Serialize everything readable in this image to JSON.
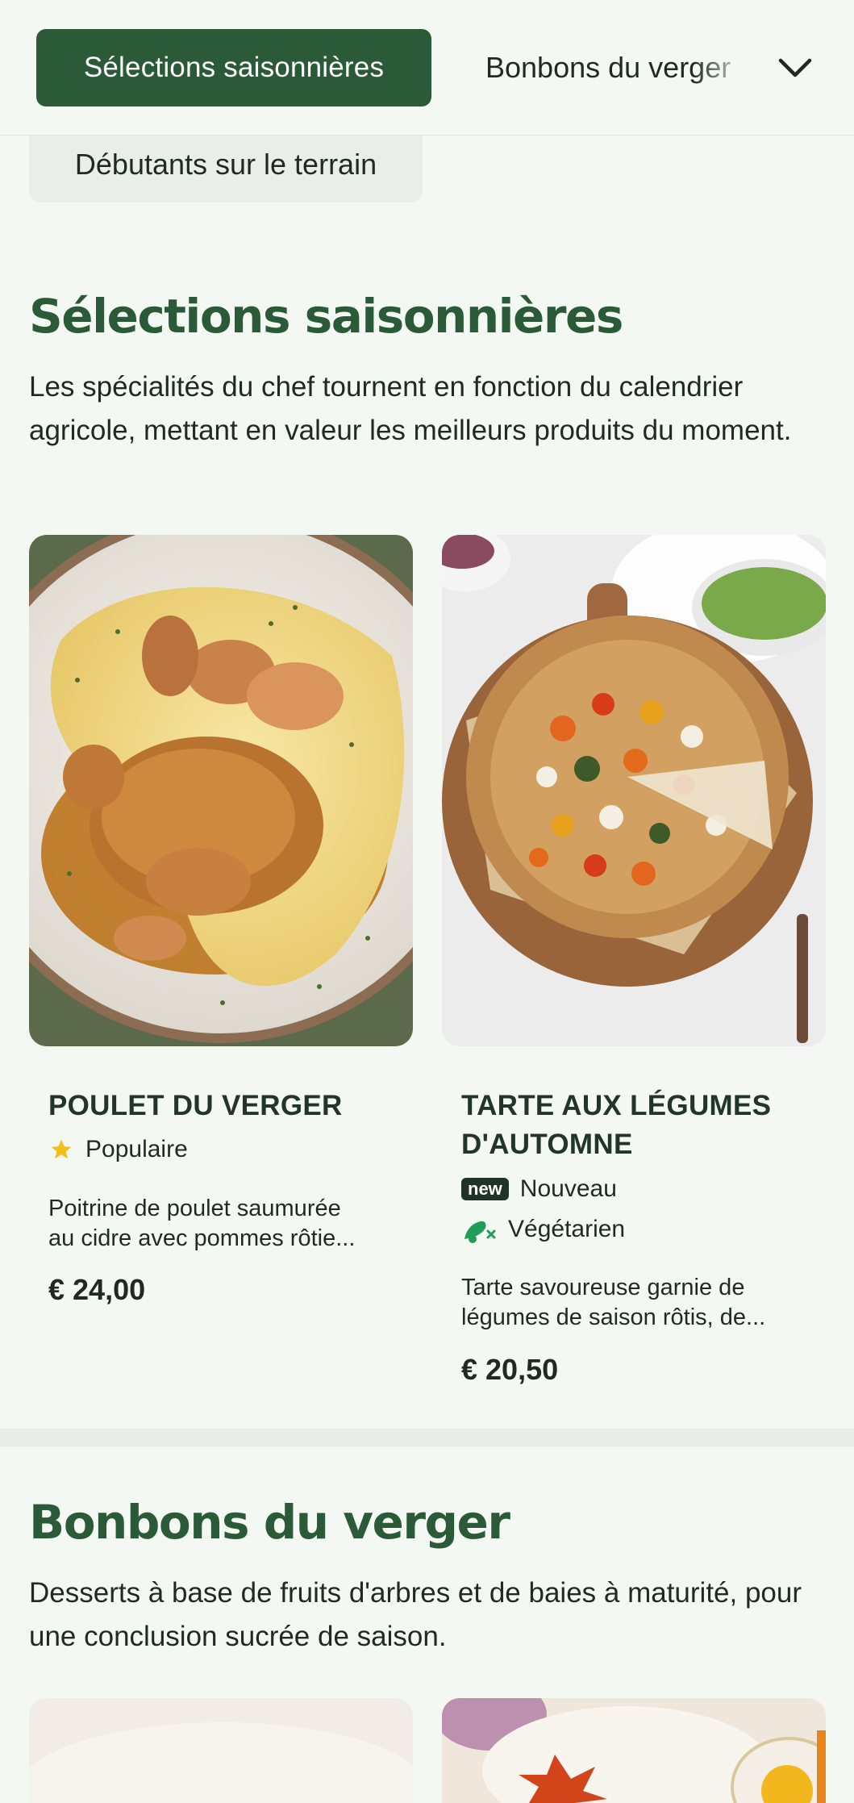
{
  "nav": {
    "active_chip": "Sélections saisonnières",
    "next_chip": "Bonbons du verger",
    "hidden_chip": "Débutants sur le terrain"
  },
  "sections": [
    {
      "title": "Sélections saisonnières",
      "description": "Les spécialités du chef tournent en fonction du calendrier agricole, mettant en valeur les meilleurs produits du moment.",
      "items": [
        {
          "name": "POULET DU VERGER",
          "tag1": "Populaire",
          "description_line1": "Poitrine de poulet saumurée",
          "description_line2": "au cidre avec pommes rôtie...",
          "price": "€ 24,00"
        },
        {
          "name_line1": "TARTE AUX LÉGUMES",
          "name_line2": "D'AUTOMNE",
          "new_badge": "new",
          "tag1": "Nouveau",
          "tag2": "Végétarien",
          "description_line1": "Tarte savoureuse garnie de",
          "description_line2": "légumes de saison rôtis, de...",
          "price": "€ 20,50"
        }
      ]
    },
    {
      "title": "Bonbons du verger",
      "description": "Desserts à base de fruits d'arbres et de baies à maturité, pour une conclusion sucrée de saison."
    }
  ],
  "colors": {
    "brand_green": "#2b5a38",
    "page_bg": "#f4f8f3",
    "star": "#f2c01c",
    "veg_icon": "#1f9e5a"
  },
  "icons": [
    "chevron-down-icon",
    "star-icon",
    "vegetarian-icon"
  ]
}
